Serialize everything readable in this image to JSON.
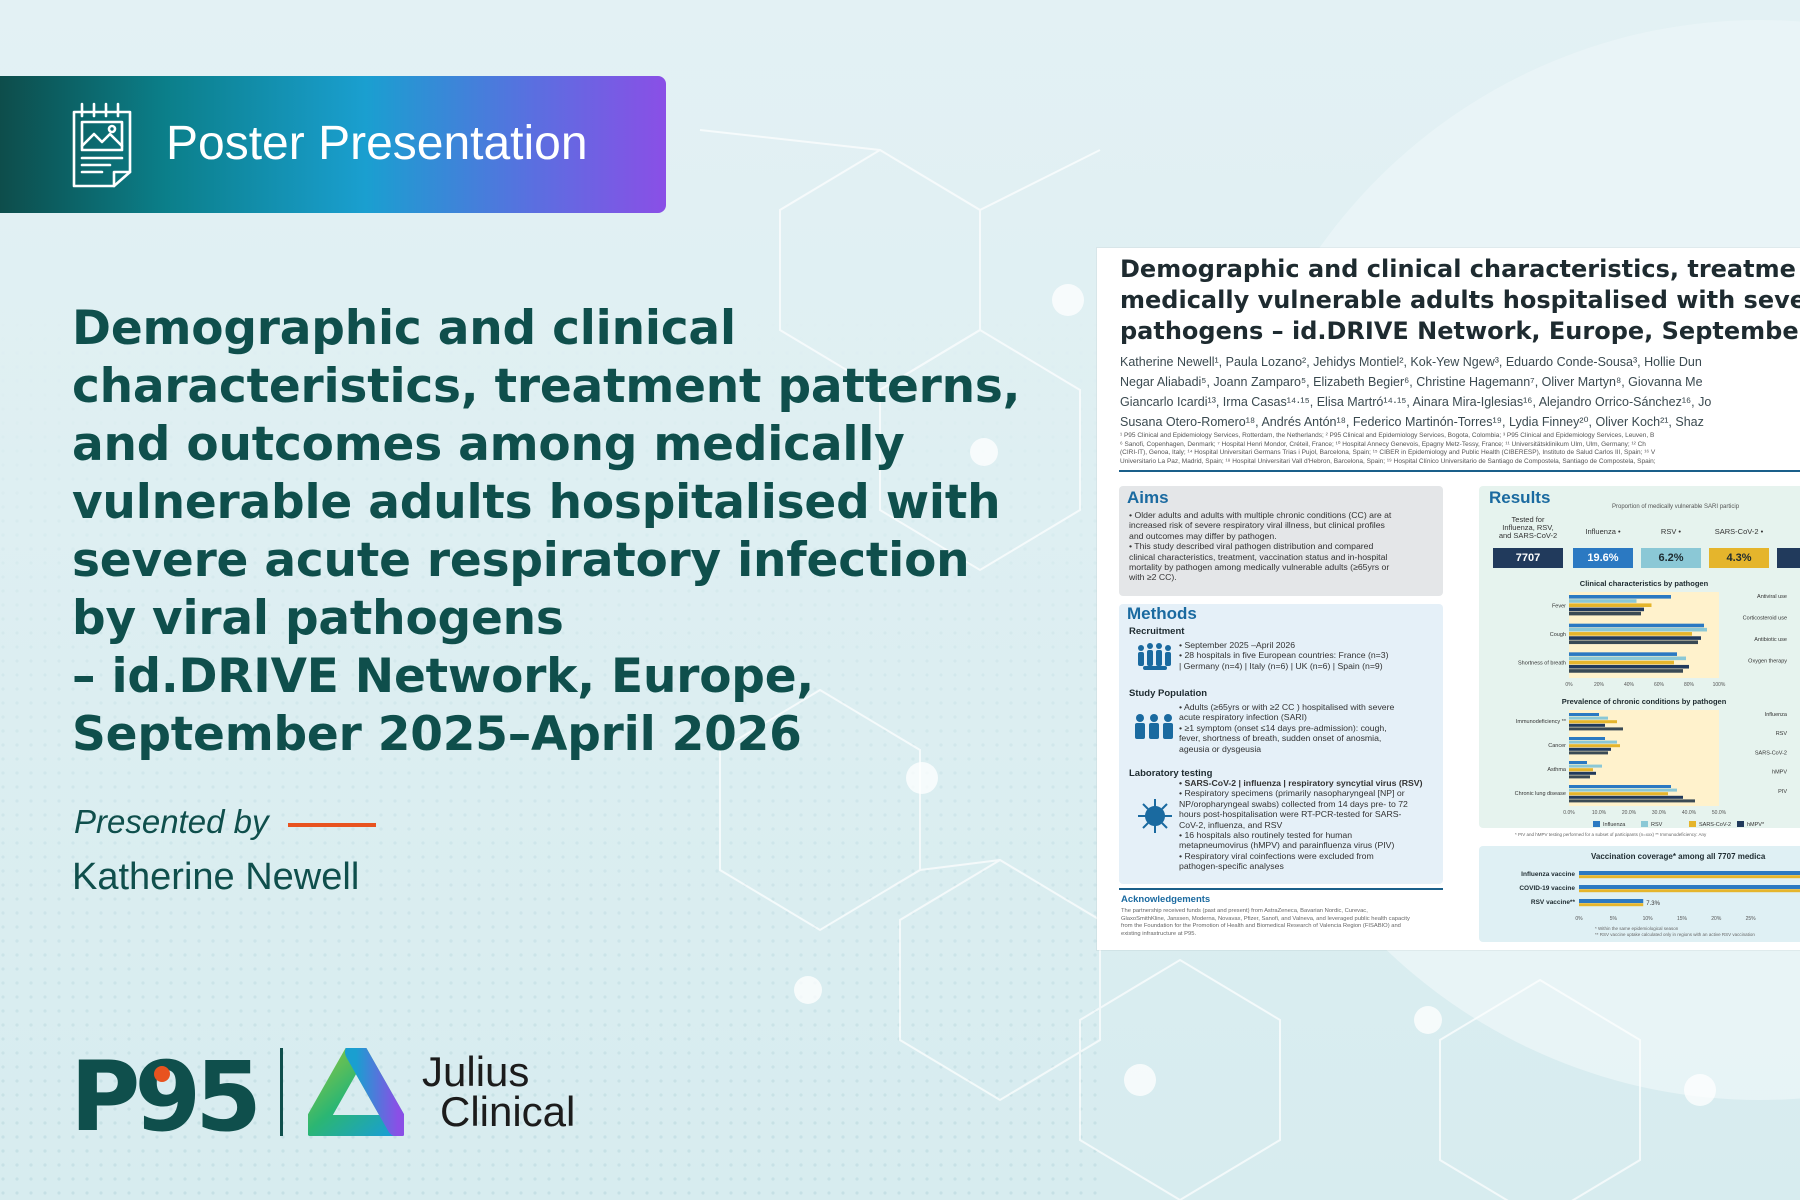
{
  "banner": {
    "title": "Poster Presentation",
    "icon": "poster-icon"
  },
  "main": {
    "title_lines": [
      "Demographic and clinical",
      "characteristics, treatment patterns,",
      "and outcomes among medically",
      "vulnerable adults hospitalised with",
      "severe acute respiratory infection",
      "by viral pathogens",
      "– id.DRIVE Network, Europe,",
      "September 2025–April 2026"
    ],
    "presented_by": "Presented by",
    "presenter": "Katherine Newell",
    "accent_color": "#e8531f"
  },
  "logos": {
    "p95": {
      "text": "P95",
      "dot_color": "#e8531f"
    },
    "julius": {
      "line1": "Julius",
      "line2": "Clinical"
    }
  },
  "poster": {
    "title_lines": [
      "Demographic and clinical characteristics, treatme",
      "medically vulnerable adults hospitalised with seve",
      "pathogens – id.DRIVE Network, Europe, Septembe"
    ],
    "authors_lines": [
      "Katherine Newell¹, Paula Lozano², Jehidys Montiel², Kok-Yew Ngew³, Eduardo Conde-Sousa³, Hollie Dun",
      "Negar Aliabadi⁵,  Joann Zamparo⁵, Elizabeth Begier⁶, Christine Hagemann⁷, Oliver Martyn⁸, Giovanna Me",
      "Giancarlo Icardi¹³, Irma Casas¹⁴·¹⁵, Elisa Martró¹⁴·¹⁵, Ainara Mira-Iglesias¹⁶, Alejandro Orrico-Sánchez¹⁶, Jo",
      "Susana Otero-Romero¹⁸, Andrés Antón¹⁸, Federico Martinón-Torres¹⁹, Lydia Finney²⁰, Oliver Koch²¹, Shaz"
    ],
    "affiliations_lines": [
      "¹ P95 Clinical and Epidemiology Services, Rotterdam, the Netherlands; ² P95 Clinical and Epidemiology Services, Bogota, Colombia; ³ P95 Clinical and Epidemiology Services, Leuven, B",
      "⁶ Sanofi, Copenhagen, Denmark; ⁷ Hospital Henri Mondor, Créteil, France; ¹⁰ Hospital Annecy Genevois, Epagny Metz-Tessy, France; ¹¹ Universitätsklinikum Ulm, Ulm, Germany; ¹² Ch",
      "(CIRI-IT), Genoa, Italy; ¹⁴ Hospital Universitari Germans Trias i Pujol, Barcelona, Spain; ¹⁵ CIBER in Epidemiology and Public Health (CIBERESP), Instituto de Salud Carlos III, Spain; ¹⁶ V",
      "Universitario La Paz, Madrid, Spain; ¹⁸ Hospital Universitari Vall d'Hebron, Barcelona, Spain; ¹⁹ Hospital Clínico Universitario de Santiago de Compostela, Santiago de Compostela, Spain;"
    ],
    "aims": {
      "heading": "Aims",
      "lines": [
        "•  Older adults and adults with multiple chronic conditions (CC) are at",
        "    increased risk of severe respiratory viral illness, but clinical profiles",
        "    and outcomes may differ by pathogen.",
        "•  This study described viral pathogen distribution and compared",
        "    clinical characteristics, treatment, vaccination status and in-hospital",
        "    mortality by pathogen among medically vulnerable adults (≥65yrs or",
        "    with ≥2 CC)."
      ]
    },
    "methods": {
      "heading": "Methods",
      "recruitment": {
        "label": "Recruitment",
        "lines": [
          "•  September 2025 –April 2026",
          "•  28 hospitals in five European countries: France (n=3)",
          "    | Germany (n=4) | Italy (n=6) | UK (n=6) | Spain (n=9)"
        ]
      },
      "population": {
        "label": "Study Population",
        "lines": [
          "•  Adults (≥65yrs or with ≥2 CC ) hospitalised with severe",
          "    acute respiratory infection (SARI)",
          "•  ≥1 symptom (onset ≤14 days pre-admission): cough,",
          "    fever, shortness of breath, sudden onset of anosmia,",
          "    ageusia or dysgeusia"
        ]
      },
      "laboratory": {
        "label": "Laboratory testing",
        "lines": [
          "•  SARS-CoV-2 | influenza | respiratory syncytial virus (RSV)",
          "•  Respiratory specimens (primarily nasopharyngeal [NP] or",
          "    NP/oropharyngeal swabs) collected from 14 days pre- to 72",
          "    hours post-hospitalisation were RT-PCR-tested for SARS-",
          "    CoV-2, influenza, and RSV",
          "•  16 hospitals also routinely tested for human",
          "    metapneumovirus (hMPV) and parainfluenza virus (PIV)",
          "•  Respiratory viral coinfections were excluded from",
          "    pathogen-specific analyses"
        ]
      }
    },
    "acknowledgements": {
      "heading": "Acknowledgements",
      "lines": [
        "The partnership received funds (past and present) from AstraZeneca, Bavarian Nordic, Curevac,",
        "GlaxoSmithKline, Janssen, Moderna, Novavax, Pfizer, Sanofi, and Valneva, and leveraged public health capacity",
        "from the Foundation for the Promotion of Health and Biomedical Research of Valencia Region (FISABIO) and",
        "existing infrastructure at P95."
      ]
    },
    "results": {
      "heading": "Results",
      "proportion_caption": "Proportion of medically vulnerable SARI particip",
      "tested_label_lines": [
        "Tested for",
        "Influenza, RSV,",
        "and SARS-CoV-2"
      ],
      "stats": [
        {
          "label": "",
          "value": "7707",
          "color": "#213a5c"
        },
        {
          "label": "Influenza •",
          "value": "19.6%",
          "color": "#2b79c2"
        },
        {
          "label": "RSV •",
          "value": "6.2%",
          "color": "#8bc8d6"
        },
        {
          "label": "SARS-CoV-2 •",
          "value": "4.3%",
          "color": "#e5b52c"
        },
        {
          "label": "hM",
          "value": "",
          "color": "#213a5c"
        }
      ]
    },
    "vaccination": {
      "title": "Vaccination coverage* among all 7707 medica",
      "rsv_value_label": "7.3%",
      "footnotes": [
        "* Within the same epidemiological season",
        "** RSV vaccine uptake calculated only in regions with an active RSV vaccination"
      ]
    },
    "footnote_results": "* PIV and hMPV testing performed for a subset of participants (n=xxx)       ** Immunodeficiency: Any"
  },
  "chart_data": [
    {
      "type": "bar",
      "title": "Clinical characteristics by pathogen",
      "categories": [
        "Fever",
        "Cough",
        "Shortness of breath"
      ],
      "right_labels": [
        "Antiviral use",
        "Corticosteroid use",
        "Antibiotic use",
        "Oxygen therapy"
      ],
      "xlim": [
        0,
        100
      ],
      "ticks": [
        "0%",
        "20%",
        "40%",
        "60%",
        "80%",
        "100%"
      ],
      "series": [
        {
          "name": "Influenza",
          "values": [
            68,
            90,
            72
          ]
        },
        {
          "name": "RSV",
          "values": [
            45,
            92,
            78
          ]
        },
        {
          "name": "SARS-CoV-2",
          "values": [
            55,
            82,
            70
          ]
        },
        {
          "name": "hMPV*",
          "values": [
            50,
            88,
            80
          ]
        },
        {
          "name": "PIV",
          "values": [
            48,
            86,
            76
          ]
        }
      ]
    },
    {
      "type": "bar",
      "title": "Prevalence of chronic conditions by pathogen",
      "categories": [
        "Immunodeficiency **",
        "Cancer",
        "Asthma",
        "Chronic lung disease"
      ],
      "right_labels": [
        "Influenza",
        "RSV",
        "SARS-CoV-2",
        "hMPV",
        "PIV"
      ],
      "xlim": [
        0,
        50
      ],
      "ticks": [
        "0.0%",
        "10.0%",
        "20.0%",
        "30.0%",
        "40.0%",
        "50.0%"
      ],
      "series": [
        {
          "name": "Influenza",
          "values": [
            10,
            12,
            6,
            34
          ]
        },
        {
          "name": "RSV",
          "values": [
            13,
            16,
            11,
            36
          ]
        },
        {
          "name": "SARS-CoV-2",
          "values": [
            16,
            17,
            8,
            33
          ]
        },
        {
          "name": "hMPV*",
          "values": [
            12,
            14,
            9,
            38
          ]
        },
        {
          "name": "PIV",
          "values": [
            18,
            13,
            7,
            42
          ]
        }
      ],
      "legend": [
        "Influenza",
        "RSV",
        "SARS-CoV-2",
        "hMPV*"
      ]
    },
    {
      "type": "bar",
      "title": "Vaccination coverage* among all 7707 medica",
      "categories": [
        "Influenza vaccine",
        "COVID-19 vaccine",
        "RSV vaccine**"
      ],
      "xlim": [
        0,
        25
      ],
      "ticks": [
        "0%",
        "5%",
        "10%",
        "15%",
        "20%",
        "25%"
      ],
      "values": [
        40,
        35,
        7.3
      ]
    }
  ],
  "colors": {
    "series": [
      "#2b79c2",
      "#8bc8d6",
      "#e5b52c",
      "#213a5c",
      "#3a4a54"
    ],
    "highlight": "#fff2cc",
    "title": "#0f4f4c"
  }
}
